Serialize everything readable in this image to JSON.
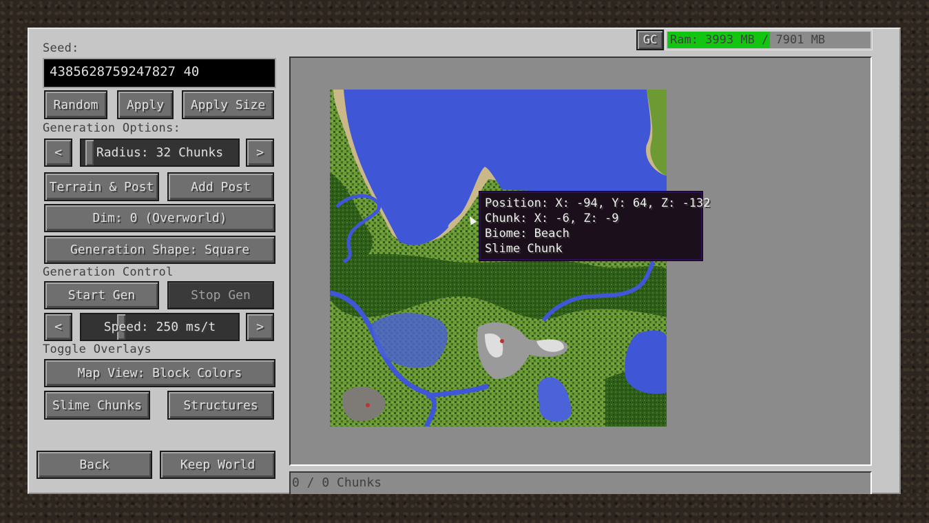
{
  "seed": {
    "label": "Seed:",
    "value": "4385628759247827 40"
  },
  "seed_buttons": {
    "random": "Random",
    "apply": "Apply",
    "apply_size": "Apply Size"
  },
  "generation_options": {
    "label": "Generation Options:",
    "radius": {
      "prev": "<",
      "next": ">",
      "label": "Radius: 32 Chunks",
      "value_fraction": 0.03
    },
    "terrain_post": "Terrain & Post",
    "add_post": "Add Post",
    "dimension": "Dim: 0 (Overworld)",
    "shape": "Generation Shape: Square"
  },
  "generation_control": {
    "label": "Generation Control",
    "start": "Start Gen",
    "stop": "Stop Gen",
    "speed": {
      "prev": "<",
      "next": ">",
      "label": "Speed: 250 ms/t",
      "value_fraction": 0.24
    }
  },
  "overlays": {
    "label": "Toggle Overlays",
    "map_view": "Map View: Block Colors",
    "slime_chunks": "Slime Chunks",
    "structures": "Structures"
  },
  "footer": {
    "back": "Back",
    "keep_world": "Keep World"
  },
  "memory": {
    "gc_label": "GC",
    "ram_text": "Ram: 3993 MB / 7901 MB",
    "used_mb": 3993,
    "total_mb": 7901,
    "fill_color": "#11c511"
  },
  "status": {
    "chunks": "0 / 0 Chunks"
  },
  "tooltip": {
    "position": "Position: X: -94, Y: 64, Z: -132",
    "chunk": "Chunk: X: -6, Z: -9",
    "biome": "Biome: Beach",
    "slime": "Slime Chunk"
  },
  "colors": {
    "water": "#3f56d6",
    "sand": "#cbb888",
    "grass": "#6e9a34",
    "forest": "#2f5e1a",
    "stone": "#8a8a8a"
  }
}
